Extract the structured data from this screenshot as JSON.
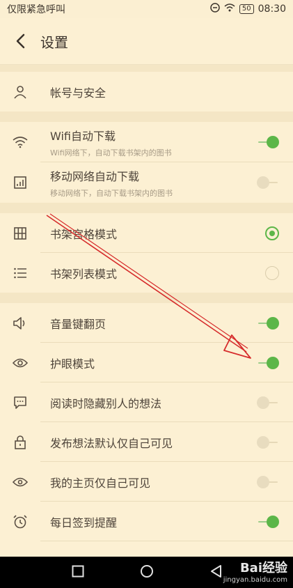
{
  "status_bar": {
    "carrier": "仅限紧急呼叫",
    "battery": "50",
    "time": "08:30"
  },
  "header": {
    "title": "设置"
  },
  "groups": [
    [
      {
        "label": "帐号与安全",
        "icon": "user-icon"
      }
    ],
    [
      {
        "label": "Wifi自动下载",
        "sub": "Wifi网络下，自动下载书架内的图书",
        "icon": "wifi-icon",
        "control": "toggle",
        "on": true
      },
      {
        "label": "移动网络自动下载",
        "sub": "移动网络下，自动下载书架内的图书",
        "icon": "bar-chart-icon",
        "control": "toggle",
        "on": false
      }
    ],
    [
      {
        "label": "书架宫格模式",
        "icon": "grid-icon",
        "control": "radio",
        "on": true
      },
      {
        "label": "书架列表模式",
        "icon": "list-icon",
        "control": "radio",
        "on": false
      }
    ],
    [
      {
        "label": "音量键翻页",
        "icon": "speaker-icon",
        "control": "toggle",
        "on": true
      },
      {
        "label": "护眼模式",
        "icon": "eye-icon",
        "control": "toggle",
        "on": true
      },
      {
        "label": "阅读时隐藏别人的想法",
        "icon": "comment-icon",
        "control": "toggle",
        "on": false
      },
      {
        "label": "发布想法默认仅自己可见",
        "icon": "lock-icon",
        "control": "toggle",
        "on": false
      },
      {
        "label": "我的主页仅自己可见",
        "icon": "eye-outline-icon",
        "control": "toggle",
        "on": false
      },
      {
        "label": "每日签到提醒",
        "icon": "alarm-icon",
        "control": "toggle",
        "on": true
      }
    ]
  ],
  "watermark": {
    "brand": "Bai经验",
    "url": "jingyan.baidu.com"
  },
  "colors": {
    "background": "#fbefd2",
    "accent": "#5cb648",
    "annotation": "#d62b2b"
  }
}
